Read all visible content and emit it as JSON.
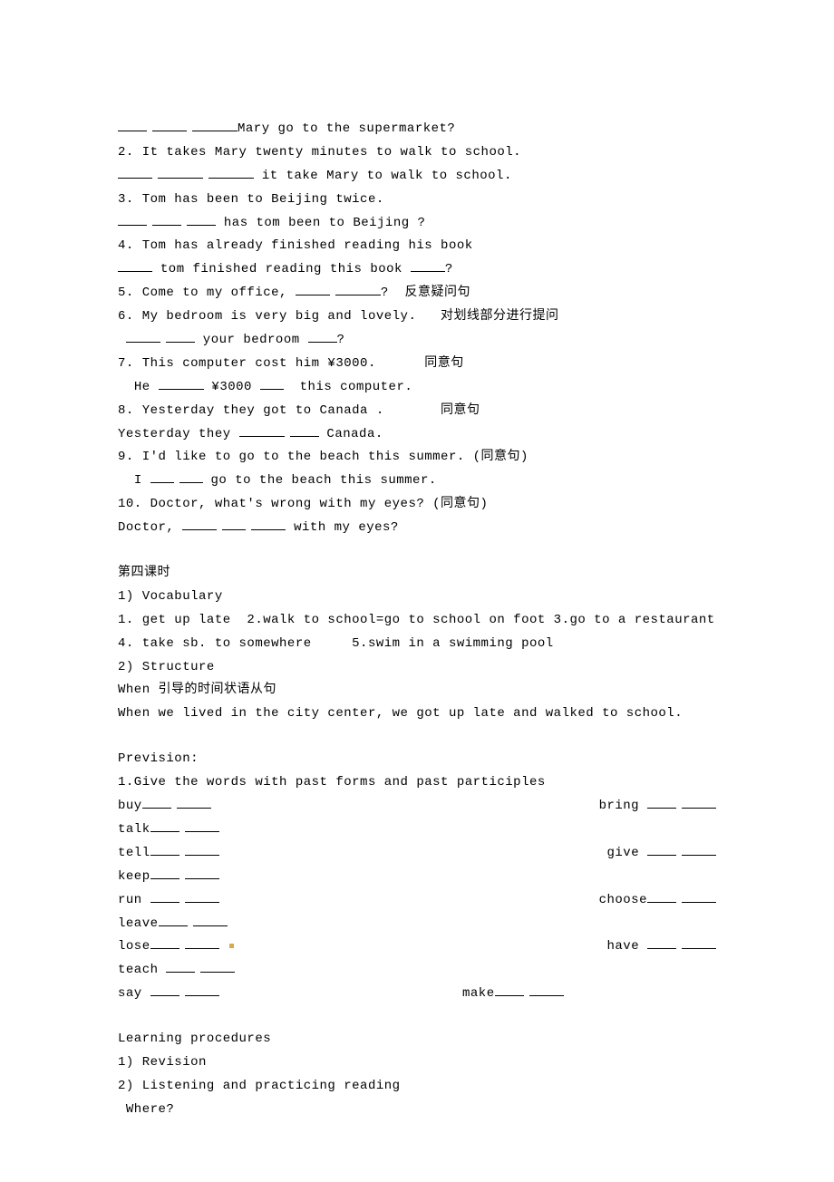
{
  "exercises": {
    "q1": {
      "post": "Mary go to the supermarket?"
    },
    "q2": {
      "line1": "2. It takes Mary twenty minutes to walk to school.",
      "post": " it take Mary to walk to school."
    },
    "q3": {
      "line1": "3. Tom has been to Beijing twice.",
      "post": " has tom been to Beijing ?"
    },
    "q4": {
      "line1": "4. Tom has already finished reading his book",
      "mid": " tom finished reading this book ",
      "end": "?"
    },
    "q5": {
      "pre": "5. Come to my office, ",
      "post": "?  反意疑问句"
    },
    "q6": {
      "line1": "6. My bedroom is very big and lovely.   对划线部分进行提问",
      "mid": " your bedroom ",
      "end": "?"
    },
    "q7": {
      "line1": "7. This computer cost him ¥3000.      同意句",
      "pre": "  He ",
      "mid": " ¥3000 ",
      "post": "  this computer."
    },
    "q8": {
      "line1": "8. Yesterday they got to Canada .       同意句",
      "pre": "Yesterday they ",
      "post": " Canada."
    },
    "q9": {
      "line1": "9. I'd like to go to the beach this summer. (同意句)",
      "pre": "  I ",
      "post": " go to the beach this summer."
    },
    "q10": {
      "line1": "10. Doctor, what's wrong with my eyes? (同意句)",
      "pre": "Doctor, ",
      "post": " with my eyes?"
    }
  },
  "lesson4": {
    "title": "第四课时",
    "vocab_title": "1) Vocabulary",
    "vocab_line1": "1. get up late  2.walk to school=go to school on foot 3.go to a restaurant",
    "vocab_line2": "4. take sb. to somewhere     5.swim in a swimming pool",
    "struct_title": "2) Structure",
    "struct1": "When 引导的时间状语从句",
    "struct2": "When we lived in the city center, we got up late and walked to school."
  },
  "prevision": {
    "title": "Prevision:",
    "instruction": "1.Give the words with past forms and past participles",
    "words": {
      "buy": "buy",
      "bring": "bring ",
      "talk": "talk",
      "tell": "tell",
      "give": "give ",
      "keep": "keep",
      "run": "run ",
      "choose": "choose",
      "leave": "leave",
      "lose": "lose",
      "have": "have ",
      "teach": "teach ",
      "say": "say ",
      "make": "make"
    }
  },
  "procedures": {
    "title": "Learning procedures",
    "item1": "1) Revision",
    "item2": "2) Listening and practicing reading",
    "item3": " Where?"
  }
}
